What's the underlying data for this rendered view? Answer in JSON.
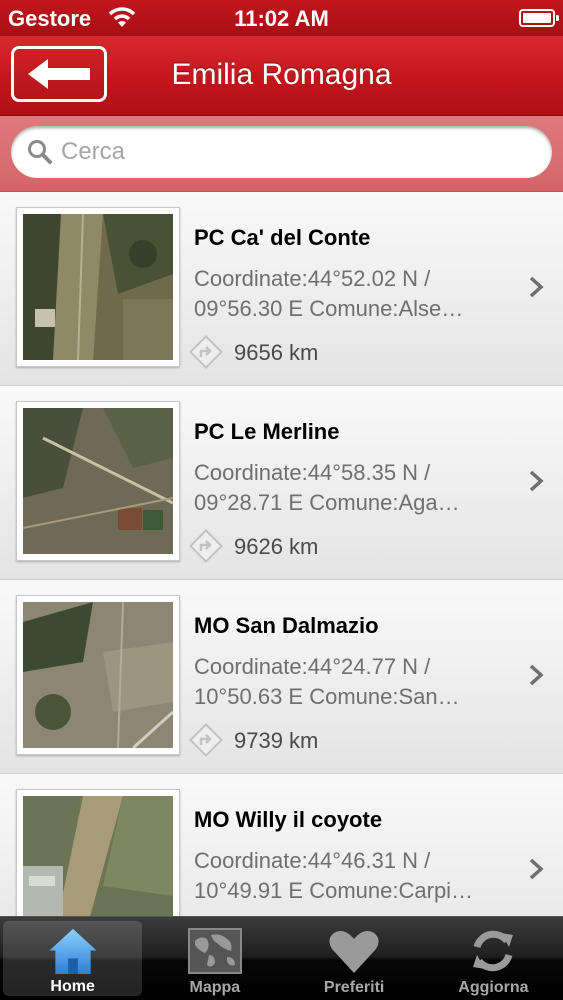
{
  "status_bar": {
    "carrier": "Gestore",
    "time": "11:02 AM"
  },
  "nav": {
    "title": "Emilia Romagna",
    "back_icon": "arrow-left-icon"
  },
  "search": {
    "placeholder": "Cerca"
  },
  "items": [
    {
      "title": "PC Ca' del Conte",
      "desc_line1": "Coordinate:44°52.02 N /",
      "desc_line2": "09°56.30 E Comune:Alse…",
      "distance": "9656 km"
    },
    {
      "title": "PC Le Merline",
      "desc_line1": "Coordinate:44°58.35 N /",
      "desc_line2": "09°28.71 E Comune:Aga…",
      "distance": "9626 km"
    },
    {
      "title": "MO San Dalmazio",
      "desc_line1": "Coordinate:44°24.77 N /",
      "desc_line2": "10°50.63 E Comune:San…",
      "distance": "9739 km"
    },
    {
      "title": "MO Willy il coyote",
      "desc_line1": "Coordinate:44°46.31 N /",
      "desc_line2": "10°49.91 E Comune:Carpi…",
      "distance": ""
    }
  ],
  "tabs": [
    {
      "label": "Home",
      "icon": "home-icon",
      "active": true
    },
    {
      "label": "Mappa",
      "icon": "map-icon",
      "active": false
    },
    {
      "label": "Preferiti",
      "icon": "heart-icon",
      "active": false
    },
    {
      "label": "Aggiorna",
      "icon": "refresh-icon",
      "active": false
    }
  ],
  "colors": {
    "header_red": "#c4151c",
    "search_band": "#d96c70",
    "tab_active": "#4aa3e8"
  }
}
